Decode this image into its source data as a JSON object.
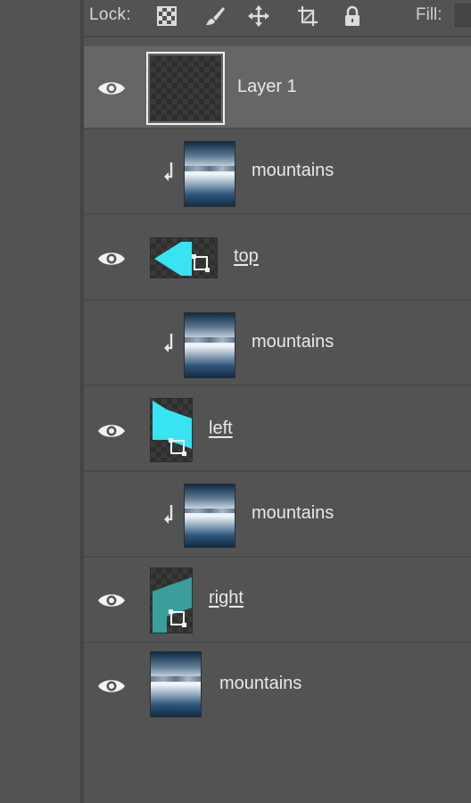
{
  "toolbar": {
    "lock_label": "Lock:",
    "lock_icons": [
      "lock-transparent-pixels-icon",
      "lock-image-pixels-icon",
      "lock-position-icon",
      "lock-artboard-icon",
      "lock-all-icon"
    ],
    "fill_label": "Fill:"
  },
  "layers": [
    {
      "name": "Layer 1",
      "visible": true,
      "selected": true,
      "clipped": false,
      "thumb": "transparent",
      "linked": false
    },
    {
      "name": "mountains",
      "visible": false,
      "selected": false,
      "clipped": true,
      "thumb": "mountains",
      "linked": false
    },
    {
      "name": "top",
      "visible": true,
      "selected": false,
      "clipped": false,
      "thumb": "shape-cyan-top",
      "linked": true
    },
    {
      "name": "mountains",
      "visible": false,
      "selected": false,
      "clipped": true,
      "thumb": "mountains",
      "linked": false
    },
    {
      "name": "left",
      "visible": true,
      "selected": false,
      "clipped": false,
      "thumb": "shape-cyan-left",
      "linked": true
    },
    {
      "name": "mountains",
      "visible": false,
      "selected": false,
      "clipped": true,
      "thumb": "mountains",
      "linked": false
    },
    {
      "name": "right",
      "visible": true,
      "selected": false,
      "clipped": false,
      "thumb": "shape-teal-right",
      "linked": true
    },
    {
      "name": "mountains",
      "visible": true,
      "selected": false,
      "clipped": false,
      "thumb": "mountains",
      "linked": false
    }
  ],
  "colors": {
    "panel_bg": "#535353",
    "selected_row": "#666666",
    "cyan_shape": "#38e3f2",
    "teal_shape": "#3a9e9c"
  }
}
